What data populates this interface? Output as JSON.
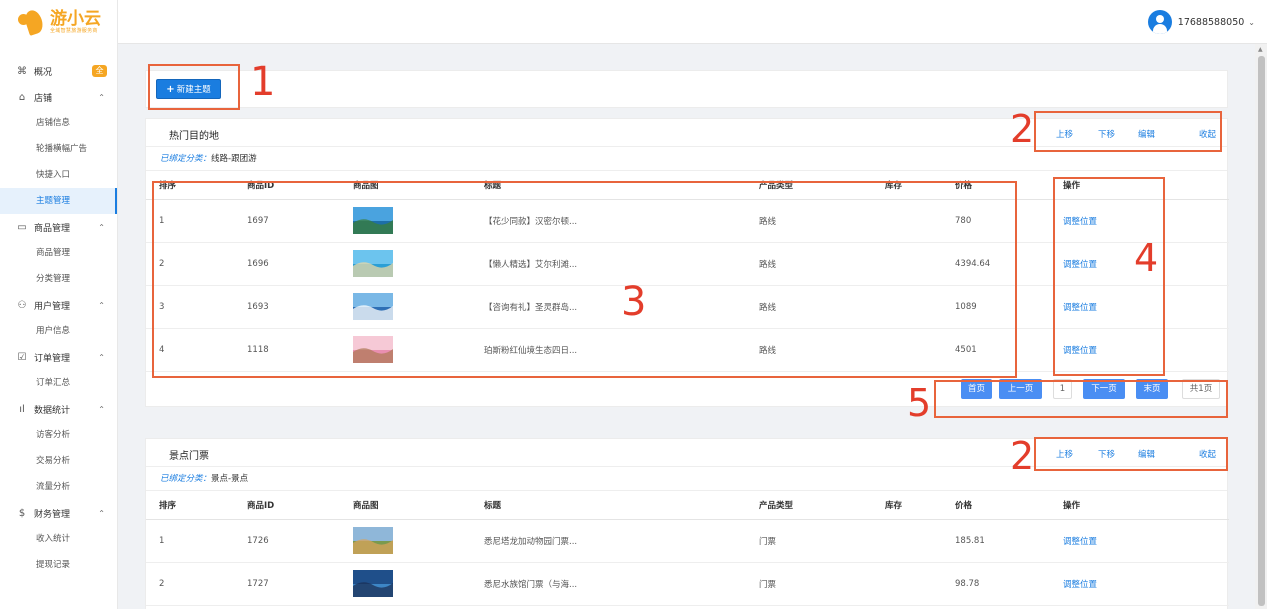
{
  "logo": {
    "name": "游小云",
    "slogan": "全域智慧旅游服务商"
  },
  "user": {
    "phone": "17688588050"
  },
  "sidebar": [
    {
      "label": "概况",
      "icon": "command-icon",
      "badge": "全"
    },
    {
      "label": "店铺",
      "icon": "home-icon",
      "items": [
        "店铺信息",
        "轮播横幅广告",
        "快捷入口",
        "主题管理"
      ]
    },
    {
      "label": "商品管理",
      "icon": "calendar-icon",
      "items": [
        "商品管理",
        "分类管理"
      ]
    },
    {
      "label": "用户管理",
      "icon": "users-icon",
      "items": [
        "用户信息"
      ]
    },
    {
      "label": "订单管理",
      "icon": "checkbox-icon",
      "items": [
        "订单汇总"
      ]
    },
    {
      "label": "数据统计",
      "icon": "bar-chart-icon",
      "items": [
        "访客分析",
        "交易分析",
        "流量分析"
      ]
    },
    {
      "label": "财务管理",
      "icon": "dollar-icon",
      "items": [
        "收入统计",
        "提现记录"
      ]
    }
  ],
  "active_item": "主题管理",
  "new_theme_button": "新建主题",
  "ops": {
    "up": "上移",
    "down": "下移",
    "edit": "编辑",
    "collapse": "收起"
  },
  "bound_label": "已绑定分类：",
  "columns": [
    "排序",
    "商品ID",
    "商品图",
    "标题",
    "产品类型",
    "库存",
    "价格",
    "操作"
  ],
  "sections": [
    {
      "title": "热门目的地",
      "category": "线路-跟团游",
      "rows": [
        {
          "order": "1",
          "id": "1697",
          "title": "【花少同款】汉密尔顿...",
          "type": "路线",
          "stock": "",
          "price": "780",
          "action": "调整位置"
        },
        {
          "order": "2",
          "id": "1696",
          "title": "【懒人精选】艾尔利滩...",
          "type": "路线",
          "stock": "",
          "price": "4394.64",
          "action": "调整位置"
        },
        {
          "order": "3",
          "id": "1693",
          "title": "【咨询有礼】圣灵群岛...",
          "type": "路线",
          "stock": "",
          "price": "1089",
          "action": "调整位置"
        },
        {
          "order": "4",
          "id": "1118",
          "title": "珀斯粉红仙境生态四日...",
          "type": "路线",
          "stock": "",
          "price": "4501",
          "action": "调整位置"
        }
      ],
      "pager": {
        "first": "首页",
        "prev": "上一页",
        "current": "1",
        "next": "下一页",
        "last": "末页",
        "total": "共1页"
      }
    },
    {
      "title": "景点门票",
      "category": "景点-景点",
      "rows": [
        {
          "order": "1",
          "id": "1726",
          "title": "悉尼塔龙加动物园门票...",
          "type": "门票",
          "stock": "",
          "price": "185.81",
          "action": "调整位置"
        },
        {
          "order": "2",
          "id": "1727",
          "title": "悉尼水族馆门票（与海...",
          "type": "门票",
          "stock": "",
          "price": "98.78",
          "action": "调整位置"
        }
      ]
    }
  ],
  "annotations": [
    "1",
    "2",
    "3",
    "4",
    "5",
    "2"
  ]
}
